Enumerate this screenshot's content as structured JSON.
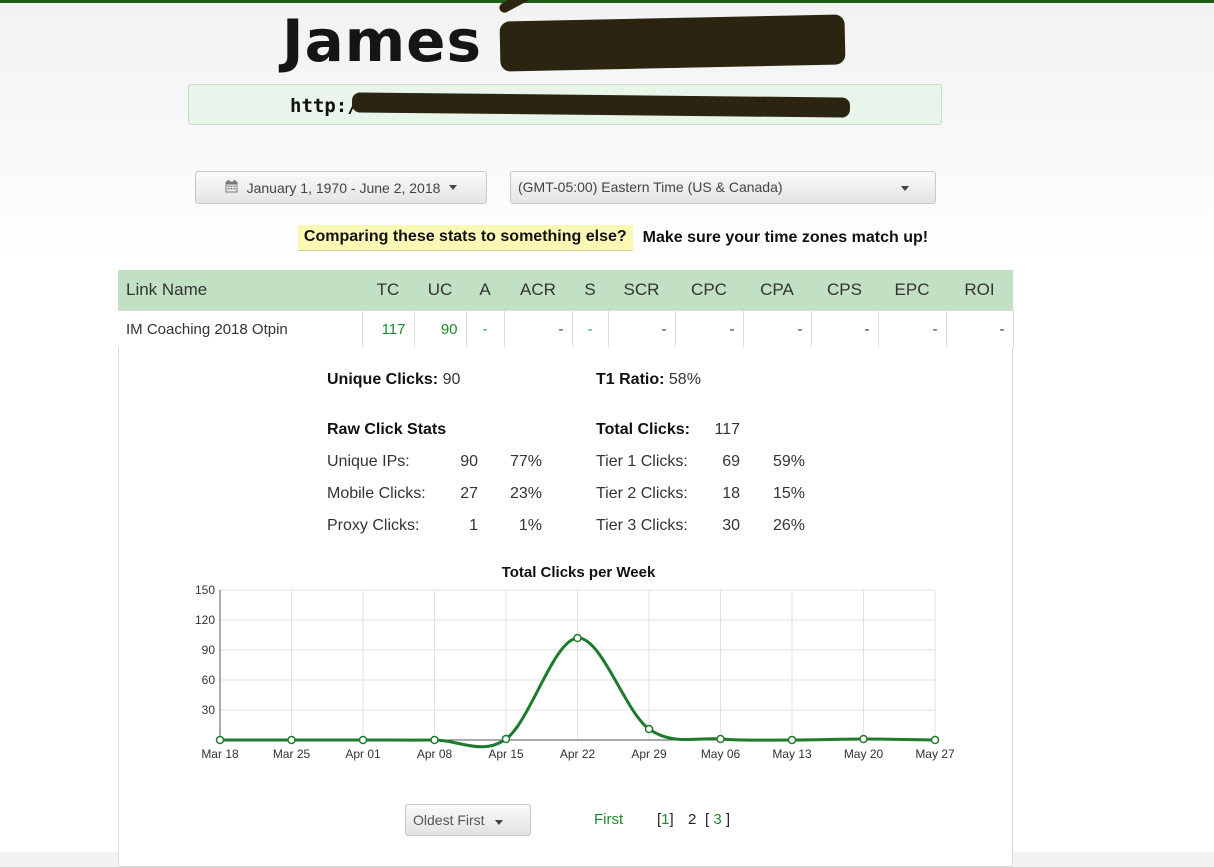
{
  "header": {
    "name": "James",
    "url_prefix": "http:/"
  },
  "controls": {
    "date_range": "January 1, 1970 - June 2, 2018",
    "timezone": "(GMT-05:00) Eastern Time (US & Canada)"
  },
  "notice": {
    "highlight": "Comparing these stats to something else?",
    "text": "Make sure your time zones match up!"
  },
  "table": {
    "headers": [
      "Link Name",
      "TC",
      "UC",
      "A",
      "ACR",
      "S",
      "SCR",
      "CPC",
      "CPA",
      "CPS",
      "EPC",
      "ROI"
    ],
    "row": [
      "IM Coaching 2018 Otpin",
      "117",
      "90",
      "-",
      "-",
      "-",
      "-",
      "-",
      "-",
      "-",
      "-",
      "-"
    ]
  },
  "summary": {
    "unique_clicks_label": "Unique Clicks:",
    "unique_clicks_value": "90",
    "t1_ratio_label": "T1 Ratio:",
    "t1_ratio_value": "58%",
    "raw_title": "Raw Click Stats",
    "total_clicks_label": "Total Clicks:",
    "total_clicks_value": "117",
    "raw_rows": [
      {
        "label": "Unique IPs:",
        "count": "90",
        "pct": "77%"
      },
      {
        "label": "Mobile Clicks:",
        "count": "27",
        "pct": "23%"
      },
      {
        "label": "Proxy Clicks:",
        "count": "1",
        "pct": "1%"
      }
    ],
    "tier_rows": [
      {
        "label": "Tier 1 Clicks:",
        "count": "69",
        "pct": "59%"
      },
      {
        "label": "Tier 2 Clicks:",
        "count": "18",
        "pct": "15%"
      },
      {
        "label": "Tier 3 Clicks:",
        "count": "30",
        "pct": "26%"
      }
    ]
  },
  "chart_data": {
    "type": "line",
    "title": "Total Clicks per Week",
    "xlabel": "",
    "ylabel": "",
    "categories": [
      "Mar 18",
      "Mar 25",
      "Apr 01",
      "Apr 08",
      "Apr 15",
      "Apr 22",
      "Apr 29",
      "May 06",
      "May 13",
      "May 20",
      "May 27"
    ],
    "values": [
      0,
      0,
      0,
      0,
      1,
      102,
      11,
      1,
      0,
      1,
      0
    ],
    "ylim": [
      0,
      150
    ],
    "yticks": [
      30,
      60,
      90,
      120,
      150
    ],
    "grid": true,
    "legend": "none",
    "color": "#1e7a2c"
  },
  "footer": {
    "sort_label": "Oldest First",
    "first_label": "First",
    "pages": [
      "1",
      "2",
      "3"
    ],
    "current_page": "2"
  }
}
